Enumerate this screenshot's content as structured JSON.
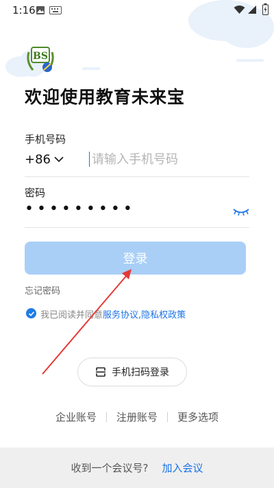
{
  "status_bar": {
    "time": "1:16"
  },
  "welcome_title": "欢迎使用教育未来宝",
  "phone": {
    "label": "手机号码",
    "country_code": "+86",
    "placeholder": "请输入手机号码"
  },
  "password": {
    "label": "密码",
    "masked_value": "•••••••••"
  },
  "login_button": "登录",
  "forgot_password": "忘记密码",
  "agreement": {
    "prefix": "我已阅读并同意",
    "service_link": "服务协议",
    "separator": ",",
    "privacy_link": "隐私权政策"
  },
  "qr_login": "手机扫码登录",
  "bottom_links": [
    "企业账号",
    "注册账号",
    "更多选项"
  ],
  "footer": {
    "question": "收到一个会议号?",
    "join": "加入会议"
  },
  "colors": {
    "accent": "#1a73e8",
    "login_button_disabled": "#a9cff7",
    "annotation_arrow": "#e53935"
  }
}
